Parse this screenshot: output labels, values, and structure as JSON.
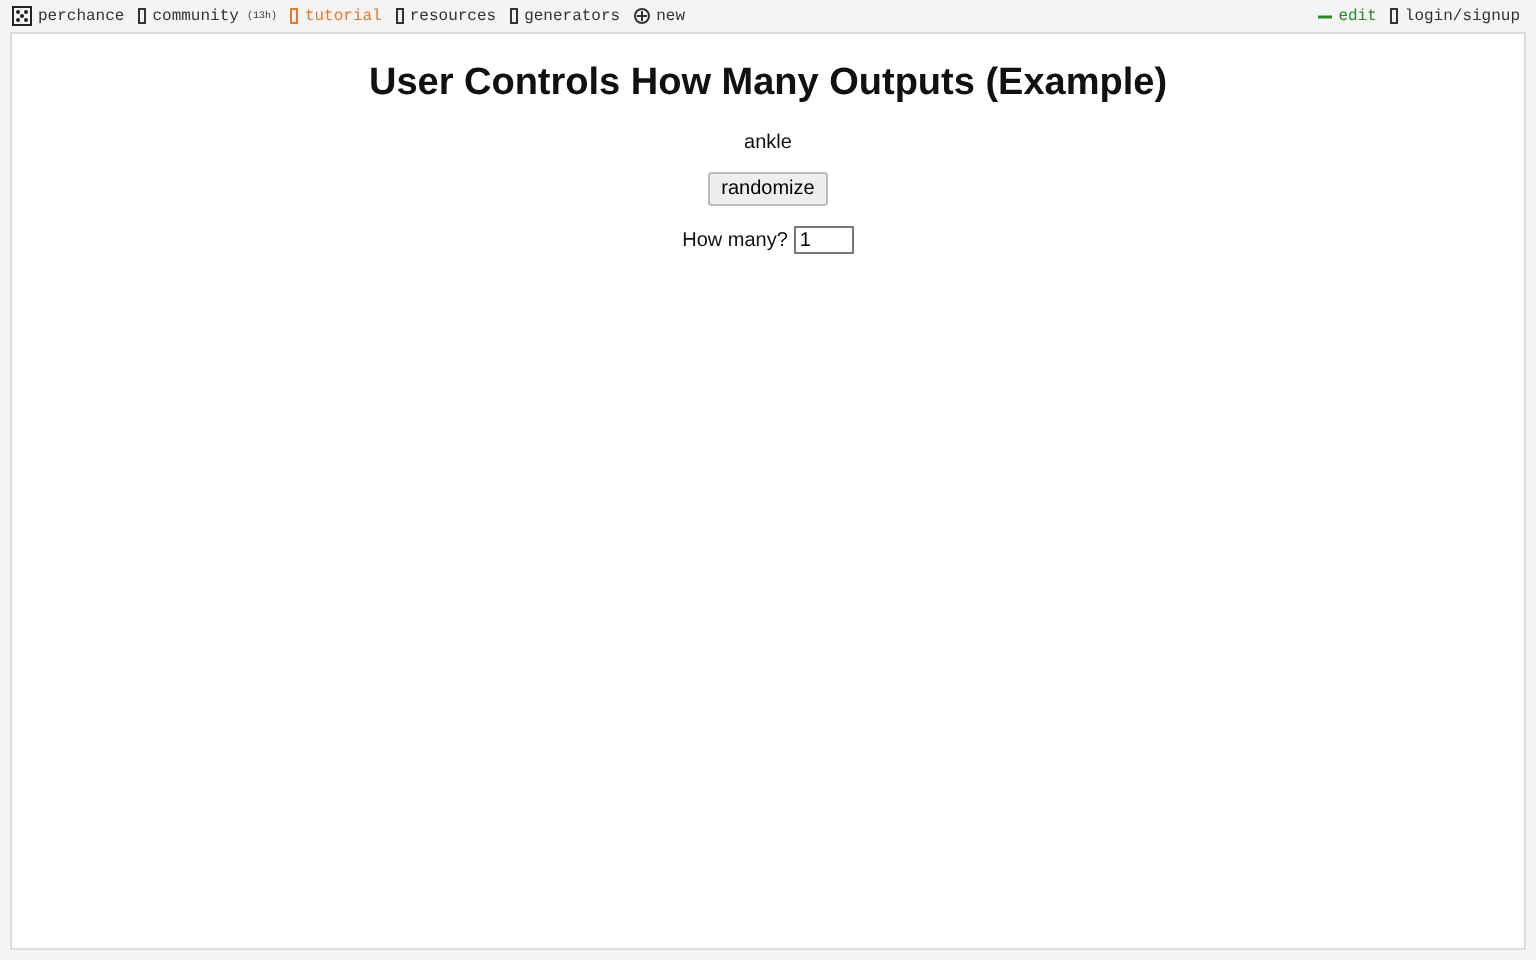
{
  "nav_left": [
    {
      "kind": "logo",
      "label": "perchance",
      "selected": false
    },
    {
      "kind": "link",
      "label": "community",
      "badge": "(13h)",
      "selected": false
    },
    {
      "kind": "link",
      "label": "tutorial",
      "selected": true
    },
    {
      "kind": "link",
      "label": "resources",
      "selected": false
    },
    {
      "kind": "link",
      "label": "generators",
      "selected": false
    },
    {
      "kind": "new",
      "label": "new",
      "selected": false
    }
  ],
  "nav_right": [
    {
      "kind": "edit",
      "label": "edit"
    },
    {
      "kind": "link",
      "label": "login/signup"
    }
  ],
  "page": {
    "title": "User Controls How Many Outputs (Example)",
    "output": "ankle",
    "button": "randomize",
    "field_label": "How many?",
    "field_value": "1"
  }
}
